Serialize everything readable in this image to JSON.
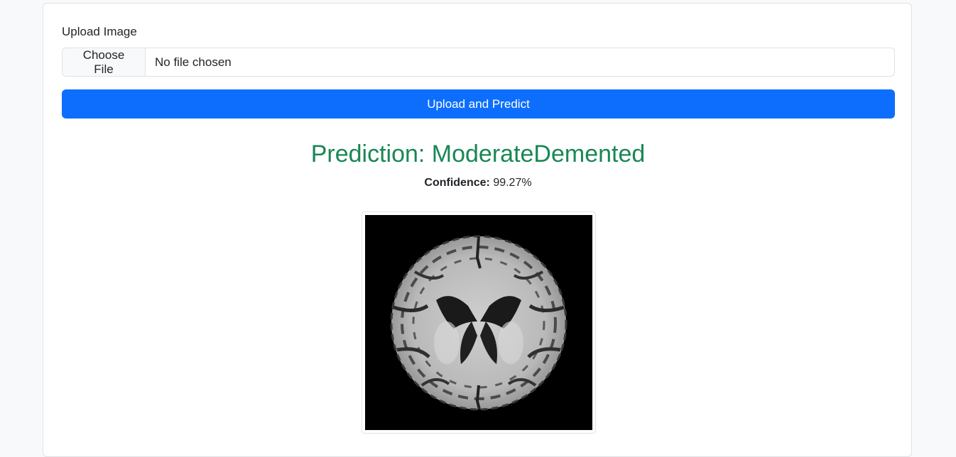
{
  "form": {
    "label": "Upload Image",
    "file_button_label": "Choose File",
    "file_status": "No file chosen",
    "submit_label": "Upload and Predict"
  },
  "result": {
    "prediction_text": "Prediction: ModerateDemented",
    "confidence_label": "Confidence:",
    "confidence_value": "99.27%"
  },
  "colors": {
    "primary": "#0d6efd",
    "success": "#198754",
    "page_background": "#f8f9fa"
  }
}
